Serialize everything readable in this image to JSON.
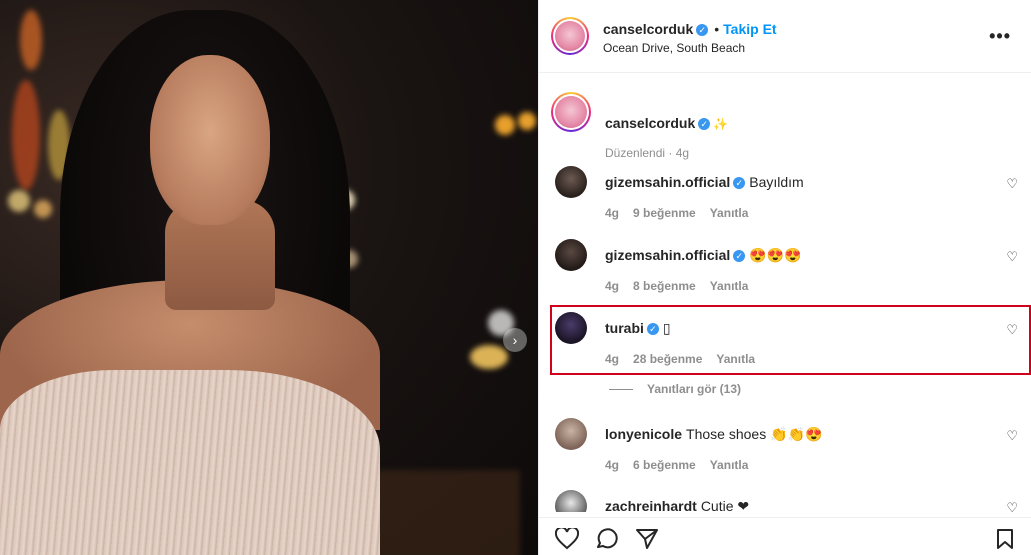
{
  "post": {
    "username": "canselcorduk",
    "follow_label": "Takip Et",
    "dot": "•",
    "location": "Ocean Drive, South Beach"
  },
  "caption": {
    "username": "canselcorduk",
    "meta": "Düzenlendi · 4g"
  },
  "comments": [
    {
      "username": "gizemsahin.official",
      "text": "Bayıldım",
      "time": "4g",
      "likes": "9 beğenme",
      "reply": "Yanıtla"
    },
    {
      "username": "gizemsahin.official",
      "text": "😍😍😍",
      "time": "4g",
      "likes": "8 beğenme",
      "reply": "Yanıtla"
    },
    {
      "username": "turabi",
      "text": "▯",
      "time": "4g",
      "likes": "28 beğenme",
      "reply": "Yanıtla"
    },
    {
      "username": "lonyenicole",
      "text": "Those shoes 👏👏😍",
      "time": "4g",
      "likes": "6 beğenme",
      "reply": "Yanıtla"
    },
    {
      "username": "zachreinhardt",
      "text": "Cutie ❤",
      "time": "",
      "likes": "",
      "reply": ""
    }
  ],
  "view_replies": "Yanıtları gör (13)",
  "icons": {
    "more": "more-options-icon",
    "like": "heart-icon",
    "comment": "comment-icon",
    "share": "share-icon",
    "save": "bookmark-icon"
  },
  "colors": {
    "accent": "#0095f6",
    "highlight": "#d0021b",
    "verified": "#3897f0"
  }
}
